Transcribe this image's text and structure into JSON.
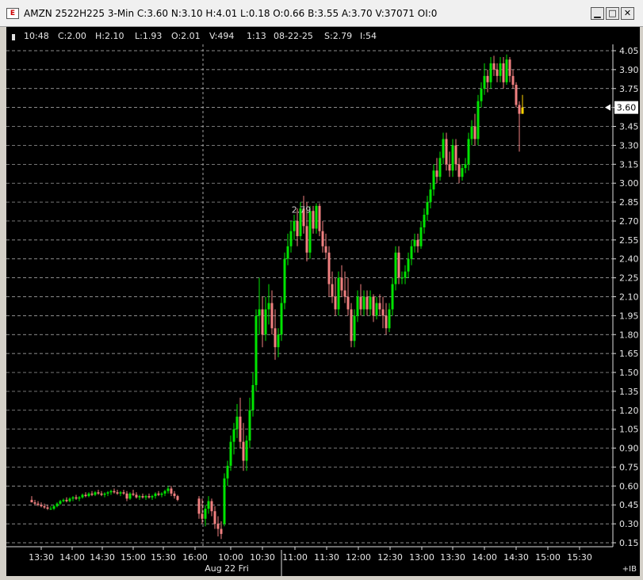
{
  "window": {
    "icon_label": "E",
    "title": "AMZN 2522H225 3-Min C:3.60 N:3.10 H:4.01 L:0.18 O:0.66 B:3.55 A:3.70 V:37071 OI:0",
    "buttons": {
      "minimize": "▁",
      "maximize": "□",
      "close": "✕"
    }
  },
  "info_bar": {
    "time": "10:48",
    "close": "C:2.00",
    "high": "H:2.10",
    "low": "L:1.93",
    "open": "O:2.01",
    "volume": "V:494",
    "ratio": "1:13",
    "date": "08-22-25",
    "s": "S:2.79",
    "i": "I:54"
  },
  "colors": {
    "background": "#000000",
    "up_bar": "#00e400",
    "down_bar": "#f08080",
    "grid": "#bbbbbb",
    "current_bar": "#ffd400"
  },
  "chart_data": {
    "type": "candlestick",
    "y_axis": {
      "min": 0.15,
      "max": 4.05,
      "ticks": [
        "4.05",
        "3.90",
        "3.75",
        "3.60",
        "3.45",
        "3.30",
        "3.15",
        "3.00",
        "2.85",
        "2.70",
        "2.55",
        "2.40",
        "2.25",
        "2.10",
        "1.95",
        "1.80",
        "1.65",
        "1.50",
        "1.35",
        "1.20",
        "1.05",
        "0.90",
        "0.75",
        "0.60",
        "0.45",
        "0.30",
        "0.15"
      ],
      "grid": "dashed horizontal",
      "position": "right"
    },
    "x_axis": {
      "ticks": [
        "13:30",
        "14:00",
        "14:30",
        "15:00",
        "15:30",
        "16:00",
        "10:00",
        "10:30",
        "11:00",
        "11:30",
        "12:00",
        "12:30",
        "13:00",
        "13:30",
        "14:00",
        "14:30",
        "15:00",
        "15:30"
      ],
      "session_label": "Aug 22 Fri",
      "session_break_at": "10:00",
      "corner_label": "+IB"
    },
    "last_price": "3.60",
    "annotations": [
      {
        "text": "2.79"
      }
    ],
    "series": [
      {
        "segment": "prior",
        "start": "13:21",
        "step_min": 3,
        "bars": [
          [
            0.49,
            0.52,
            0.47,
            0.47
          ],
          [
            0.47,
            0.49,
            0.45,
            0.46
          ],
          [
            0.46,
            0.48,
            0.44,
            0.45
          ],
          [
            0.45,
            0.47,
            0.43,
            0.44
          ],
          [
            0.44,
            0.46,
            0.42,
            0.43
          ],
          [
            0.43,
            0.45,
            0.41,
            0.42
          ],
          [
            0.42,
            0.44,
            0.41,
            0.42
          ],
          [
            0.42,
            0.45,
            0.41,
            0.44
          ],
          [
            0.44,
            0.47,
            0.43,
            0.46
          ],
          [
            0.46,
            0.49,
            0.45,
            0.48
          ],
          [
            0.48,
            0.5,
            0.47,
            0.49
          ],
          [
            0.49,
            0.51,
            0.47,
            0.48
          ],
          [
            0.48,
            0.51,
            0.47,
            0.5
          ],
          [
            0.5,
            0.52,
            0.48,
            0.51
          ],
          [
            0.51,
            0.53,
            0.49,
            0.5
          ],
          [
            0.5,
            0.52,
            0.48,
            0.51
          ],
          [
            0.51,
            0.54,
            0.5,
            0.53
          ],
          [
            0.53,
            0.55,
            0.51,
            0.52
          ],
          [
            0.52,
            0.55,
            0.51,
            0.54
          ],
          [
            0.54,
            0.56,
            0.52,
            0.53
          ],
          [
            0.53,
            0.56,
            0.52,
            0.55
          ],
          [
            0.55,
            0.57,
            0.53,
            0.54
          ],
          [
            0.54,
            0.56,
            0.52,
            0.53
          ],
          [
            0.53,
            0.55,
            0.51,
            0.54
          ],
          [
            0.54,
            0.56,
            0.52,
            0.55
          ],
          [
            0.55,
            0.57,
            0.53,
            0.56
          ],
          [
            0.56,
            0.58,
            0.54,
            0.55
          ],
          [
            0.55,
            0.57,
            0.53,
            0.54
          ],
          [
            0.54,
            0.56,
            0.52,
            0.55
          ],
          [
            0.55,
            0.57,
            0.53,
            0.54
          ],
          [
            0.54,
            0.56,
            0.48,
            0.5
          ],
          [
            0.5,
            0.55,
            0.49,
            0.54
          ],
          [
            0.54,
            0.57,
            0.52,
            0.53
          ],
          [
            0.53,
            0.55,
            0.5,
            0.51
          ],
          [
            0.51,
            0.53,
            0.49,
            0.52
          ],
          [
            0.52,
            0.54,
            0.5,
            0.51
          ],
          [
            0.51,
            0.53,
            0.49,
            0.52
          ],
          [
            0.52,
            0.54,
            0.5,
            0.51
          ],
          [
            0.51,
            0.53,
            0.49,
            0.52
          ],
          [
            0.52,
            0.55,
            0.5,
            0.54
          ],
          [
            0.54,
            0.56,
            0.52,
            0.53
          ],
          [
            0.53,
            0.55,
            0.51,
            0.54
          ],
          [
            0.54,
            0.57,
            0.52,
            0.56
          ],
          [
            0.56,
            0.6,
            0.54,
            0.58
          ],
          [
            0.58,
            0.6,
            0.52,
            0.54
          ],
          [
            0.54,
            0.56,
            0.5,
            0.52
          ],
          [
            0.52,
            0.53,
            0.48,
            0.49
          ]
        ]
      },
      {
        "segment": "current",
        "start": "09:30",
        "step_min": 3,
        "bars": [
          [
            0.5,
            0.52,
            0.34,
            0.38
          ],
          [
            0.38,
            0.5,
            0.3,
            0.34
          ],
          [
            0.34,
            0.45,
            0.28,
            0.42
          ],
          [
            0.42,
            0.52,
            0.38,
            0.48
          ],
          [
            0.48,
            0.5,
            0.36,
            0.4
          ],
          [
            0.4,
            0.44,
            0.26,
            0.3
          ],
          [
            0.3,
            0.36,
            0.2,
            0.26
          ],
          [
            0.26,
            0.32,
            0.18,
            0.22
          ],
          [
            0.3,
            0.7,
            0.28,
            0.66
          ],
          [
            0.66,
            0.8,
            0.6,
            0.76
          ],
          [
            0.76,
            1.0,
            0.72,
            0.95
          ],
          [
            0.95,
            1.1,
            0.85,
            1.05
          ],
          [
            1.05,
            1.25,
            0.98,
            1.15
          ],
          [
            1.15,
            1.3,
            0.9,
            0.95
          ],
          [
            0.95,
            1.1,
            0.72,
            0.8
          ],
          [
            0.8,
            1.0,
            0.72,
            0.96
          ],
          [
            0.96,
            1.3,
            0.9,
            1.2
          ],
          [
            1.2,
            1.5,
            1.15,
            1.4
          ],
          [
            1.4,
            2.0,
            1.35,
            1.95
          ],
          [
            1.95,
            2.25,
            1.8,
            2.0
          ],
          [
            2.0,
            2.1,
            1.7,
            1.8
          ],
          [
            1.8,
            2.1,
            1.75,
            2.0
          ],
          [
            2.0,
            2.2,
            1.88,
            2.05
          ],
          [
            2.05,
            2.15,
            1.8,
            1.85
          ],
          [
            1.85,
            2.0,
            1.6,
            1.7
          ],
          [
            1.7,
            1.85,
            1.62,
            1.8
          ],
          [
            1.8,
            2.1,
            1.75,
            2.05
          ],
          [
            2.05,
            2.45,
            2.0,
            2.4
          ],
          [
            2.4,
            2.6,
            2.35,
            2.5
          ],
          [
            2.5,
            2.7,
            2.45,
            2.62
          ],
          [
            2.62,
            2.75,
            2.55,
            2.7
          ],
          [
            2.7,
            2.8,
            2.5,
            2.58
          ],
          [
            2.58,
            2.85,
            2.55,
            2.8
          ],
          [
            2.8,
            2.9,
            2.6,
            2.66
          ],
          [
            2.66,
            2.85,
            2.38,
            2.45
          ],
          [
            2.45,
            2.82,
            2.4,
            2.78
          ],
          [
            2.78,
            2.82,
            2.6,
            2.64
          ],
          [
            2.64,
            2.84,
            2.6,
            2.82
          ],
          [
            2.82,
            2.84,
            2.58,
            2.62
          ],
          [
            2.62,
            2.7,
            2.45,
            2.5
          ],
          [
            2.5,
            2.6,
            2.4,
            2.45
          ],
          [
            2.45,
            2.5,
            2.1,
            2.2
          ],
          [
            2.2,
            2.3,
            2.05,
            2.1
          ],
          [
            2.1,
            2.25,
            1.95,
            2.0
          ],
          [
            2.0,
            2.3,
            1.95,
            2.25
          ],
          [
            2.25,
            2.35,
            2.1,
            2.15
          ],
          [
            2.15,
            2.3,
            2.05,
            2.1
          ],
          [
            2.1,
            2.25,
            1.95,
            2.0
          ],
          [
            2.0,
            2.05,
            1.7,
            1.75
          ],
          [
            1.75,
            2.0,
            1.7,
            1.95
          ],
          [
            1.95,
            2.15,
            1.9,
            2.1
          ],
          [
            2.1,
            2.2,
            1.95,
            2.0
          ],
          [
            2.0,
            2.15,
            1.95,
            2.1
          ],
          [
            2.1,
            2.15,
            1.95,
            2.0
          ],
          [
            2.0,
            2.15,
            1.95,
            2.1
          ],
          [
            2.1,
            2.12,
            1.9,
            1.95
          ],
          [
            1.95,
            2.1,
            1.92,
            2.05
          ],
          [
            2.05,
            2.12,
            1.95,
            2.0
          ],
          [
            2.0,
            2.1,
            1.85,
            1.95
          ],
          [
            1.95,
            2.05,
            1.8,
            1.85
          ],
          [
            1.85,
            2.05,
            1.82,
            2.0
          ],
          [
            2.0,
            2.25,
            1.95,
            2.2
          ],
          [
            2.2,
            2.5,
            2.15,
            2.45
          ],
          [
            2.45,
            2.5,
            2.2,
            2.25
          ],
          [
            2.25,
            2.3,
            2.2,
            2.25
          ],
          [
            2.25,
            2.35,
            2.2,
            2.3
          ],
          [
            2.3,
            2.45,
            2.25,
            2.4
          ],
          [
            2.4,
            2.55,
            2.35,
            2.5
          ],
          [
            2.5,
            2.6,
            2.45,
            2.55
          ],
          [
            2.55,
            2.6,
            2.45,
            2.5
          ],
          [
            2.5,
            2.7,
            2.48,
            2.65
          ],
          [
            2.65,
            2.8,
            2.6,
            2.75
          ],
          [
            2.75,
            2.9,
            2.7,
            2.85
          ],
          [
            2.85,
            3.0,
            2.8,
            2.95
          ],
          [
            2.95,
            3.15,
            2.9,
            3.1
          ],
          [
            3.1,
            3.2,
            3.0,
            3.05
          ],
          [
            3.05,
            3.25,
            3.02,
            3.2
          ],
          [
            3.2,
            3.4,
            3.15,
            3.35
          ],
          [
            3.35,
            3.4,
            3.1,
            3.15
          ],
          [
            3.15,
            3.25,
            3.05,
            3.1
          ],
          [
            3.1,
            3.35,
            3.05,
            3.3
          ],
          [
            3.3,
            3.35,
            3.1,
            3.15
          ],
          [
            3.15,
            3.2,
            3.0,
            3.05
          ],
          [
            3.05,
            3.15,
            3.02,
            3.12
          ],
          [
            3.12,
            3.2,
            3.08,
            3.15
          ],
          [
            3.15,
            3.4,
            3.1,
            3.35
          ],
          [
            3.35,
            3.5,
            3.3,
            3.45
          ],
          [
            3.45,
            3.55,
            3.3,
            3.35
          ],
          [
            3.35,
            3.7,
            3.3,
            3.65
          ],
          [
            3.65,
            3.8,
            3.6,
            3.75
          ],
          [
            3.75,
            3.95,
            3.7,
            3.85
          ],
          [
            3.85,
            3.9,
            3.72,
            3.8
          ],
          [
            3.8,
            4.0,
            3.75,
            3.95
          ],
          [
            3.95,
            4.01,
            3.85,
            3.9
          ],
          [
            3.9,
            3.95,
            3.8,
            3.85
          ],
          [
            3.85,
            4.0,
            3.8,
            3.95
          ],
          [
            3.95,
            4.0,
            3.75,
            3.8
          ],
          [
            3.8,
            4.02,
            3.78,
            3.98
          ],
          [
            3.98,
            4.0,
            3.8,
            3.85
          ],
          [
            3.85,
            3.9,
            3.75,
            3.78
          ],
          [
            3.78,
            3.8,
            3.6,
            3.62
          ],
          [
            3.62,
            3.65,
            3.25,
            3.55
          ],
          [
            3.55,
            3.7,
            3.55,
            3.6
          ]
        ]
      }
    ]
  }
}
